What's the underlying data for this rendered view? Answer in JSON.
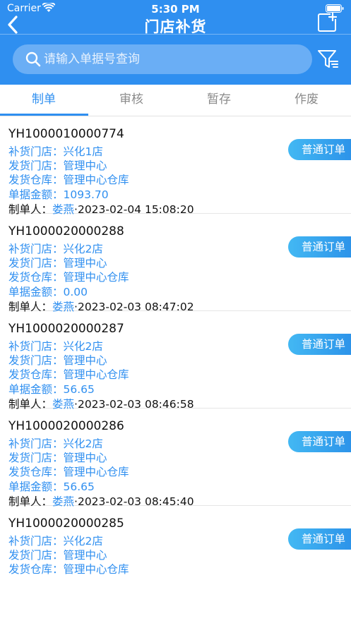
{
  "status_bar": {
    "carrier": "Carrier",
    "time": "5:30 PM",
    "battery_level": 1.0
  },
  "nav": {
    "title": "门店补货",
    "back_icon": "chevron-left-icon",
    "add_icon": "add-document-icon"
  },
  "search": {
    "placeholder": "请输入单据号查询",
    "value": "",
    "filter_icon": "filter-icon"
  },
  "tabs": [
    {
      "label": "制单",
      "active": true
    },
    {
      "label": "审核",
      "active": false
    },
    {
      "label": "暂存",
      "active": false
    },
    {
      "label": "作废",
      "active": false
    }
  ],
  "colors": {
    "accent": "#2f8ff0",
    "badge_start": "#43b8f3",
    "badge_end": "#2a8fe8"
  },
  "orders": [
    {
      "order_no": "YH1000010000774",
      "store": "补货门店：兴化1店",
      "ship_store": "发货门店：管理中心",
      "warehouse": "发货仓库：管理中心仓库",
      "amount": "单据金额：1093.70",
      "creator_label": "制单人：",
      "creator_name": "娄燕",
      "created": "·2023-02-04 15:08:20",
      "badge": "普通订单"
    },
    {
      "order_no": "YH1000020000288",
      "store": "补货门店：兴化2店",
      "ship_store": "发货门店：管理中心",
      "warehouse": "发货仓库：管理中心仓库",
      "amount": "单据金额：0.00",
      "creator_label": "制单人：",
      "creator_name": "娄燕",
      "created": "·2023-02-03 08:47:02",
      "badge": "普通订单"
    },
    {
      "order_no": "YH1000020000287",
      "store": "补货门店：兴化2店",
      "ship_store": "发货门店：管理中心",
      "warehouse": "发货仓库：管理中心仓库",
      "amount": "单据金额：56.65",
      "creator_label": "制单人：",
      "creator_name": "娄燕",
      "created": "·2023-02-03 08:46:58",
      "badge": "普通订单"
    },
    {
      "order_no": "YH1000020000286",
      "store": "补货门店：兴化2店",
      "ship_store": "发货门店：管理中心",
      "warehouse": "发货仓库：管理中心仓库",
      "amount": "单据金额：56.65",
      "creator_label": "制单人：",
      "creator_name": "娄燕",
      "created": "·2023-02-03 08:45:40",
      "badge": "普通订单"
    },
    {
      "order_no": "YH1000020000285",
      "store": "补货门店：兴化2店",
      "ship_store": "发货门店：管理中心",
      "warehouse": "发货仓库：管理中心仓库",
      "badge": "普通订单"
    }
  ]
}
